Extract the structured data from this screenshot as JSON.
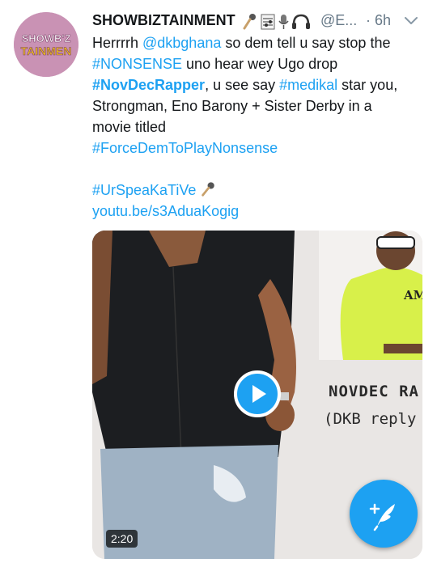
{
  "tweet": {
    "author_name": "SHOWBIZTAINMENT",
    "author_emojis": [
      "microphone-icon",
      "music-score-icon",
      "studio-mic-icon",
      "headphones-icon"
    ],
    "handle": "@E...",
    "time": "· 6h",
    "avatar_text_1": "SHOWB'Z",
    "avatar_text_2": "TAINMEN",
    "lines": {
      "l1_a": "Herrrrh ",
      "l1_mention": "@dkbghana",
      "l1_b": " so dem tell u say stop the",
      "l2_tag": "#NONSENSE",
      "l2_b": " uno hear wey Ugo drop",
      "l3_tag": "#NovDecRapper",
      "l3_b": ", u see say ",
      "l3_tag2": "#medikal",
      "l3_c": " star you,",
      "l4": "Strongman, Eno Barony + Sister Derby in a",
      "l5": "movie titled",
      "l6_tag": "#ForceDemToPlayNonsense",
      "l8_tag": "#UrSpeaKaTiVe",
      "l9_link": "youtu.be/s3AduaKogig"
    },
    "video": {
      "duration": "2:20",
      "overlay_title": "NOVDEC RA",
      "overlay_sub": "(DKB reply t",
      "hoodie_text": "AMG"
    }
  },
  "colors": {
    "link": "#1da1f2",
    "text": "#14171a",
    "muted": "#657786",
    "fab": "#1da1f2"
  }
}
